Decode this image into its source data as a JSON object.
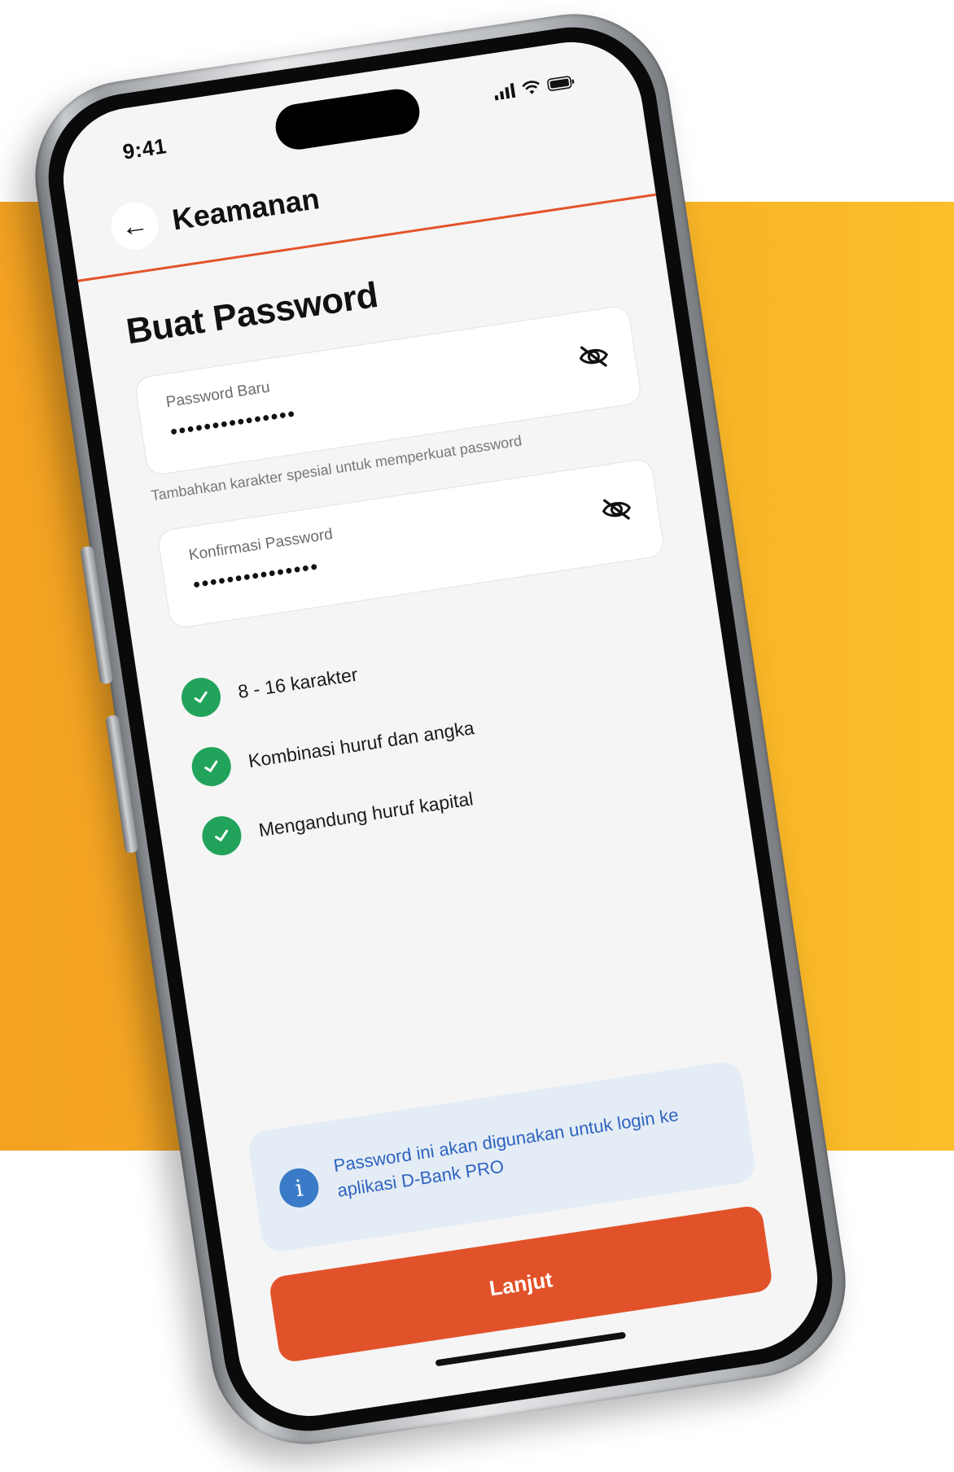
{
  "status_bar": {
    "time": "9:41"
  },
  "header": {
    "back_glyph": "←",
    "title": "Keamanan"
  },
  "page": {
    "title": "Buat Password"
  },
  "fields": {
    "new_password": {
      "label": "Password Baru",
      "value": "•••••••••••••••"
    },
    "helper": "Tambahkan karakter spesial untuk memperkuat password",
    "confirm_password": {
      "label": "Konfirmasi Password",
      "value": "•••••••••••••••"
    }
  },
  "requirements": [
    {
      "label": "8 - 16 karakter"
    },
    {
      "label": "Kombinasi huruf dan angka"
    },
    {
      "label": "Mengandung huruf kapital"
    }
  ],
  "info": {
    "icon_glyph": "i",
    "text": "Password ini akan digunakan untuk login ke aplikasi D-Bank PRO"
  },
  "cta": {
    "label": "Lanjut"
  },
  "colors": {
    "accent": "#e2522a",
    "success": "#22a35b",
    "info": "#3a7bc8",
    "background": "#f6ad25"
  },
  "icons": [
    "signal-icon",
    "wifi-icon",
    "battery-icon",
    "back-arrow-icon",
    "eye-off-icon",
    "check-icon",
    "info-icon"
  ]
}
